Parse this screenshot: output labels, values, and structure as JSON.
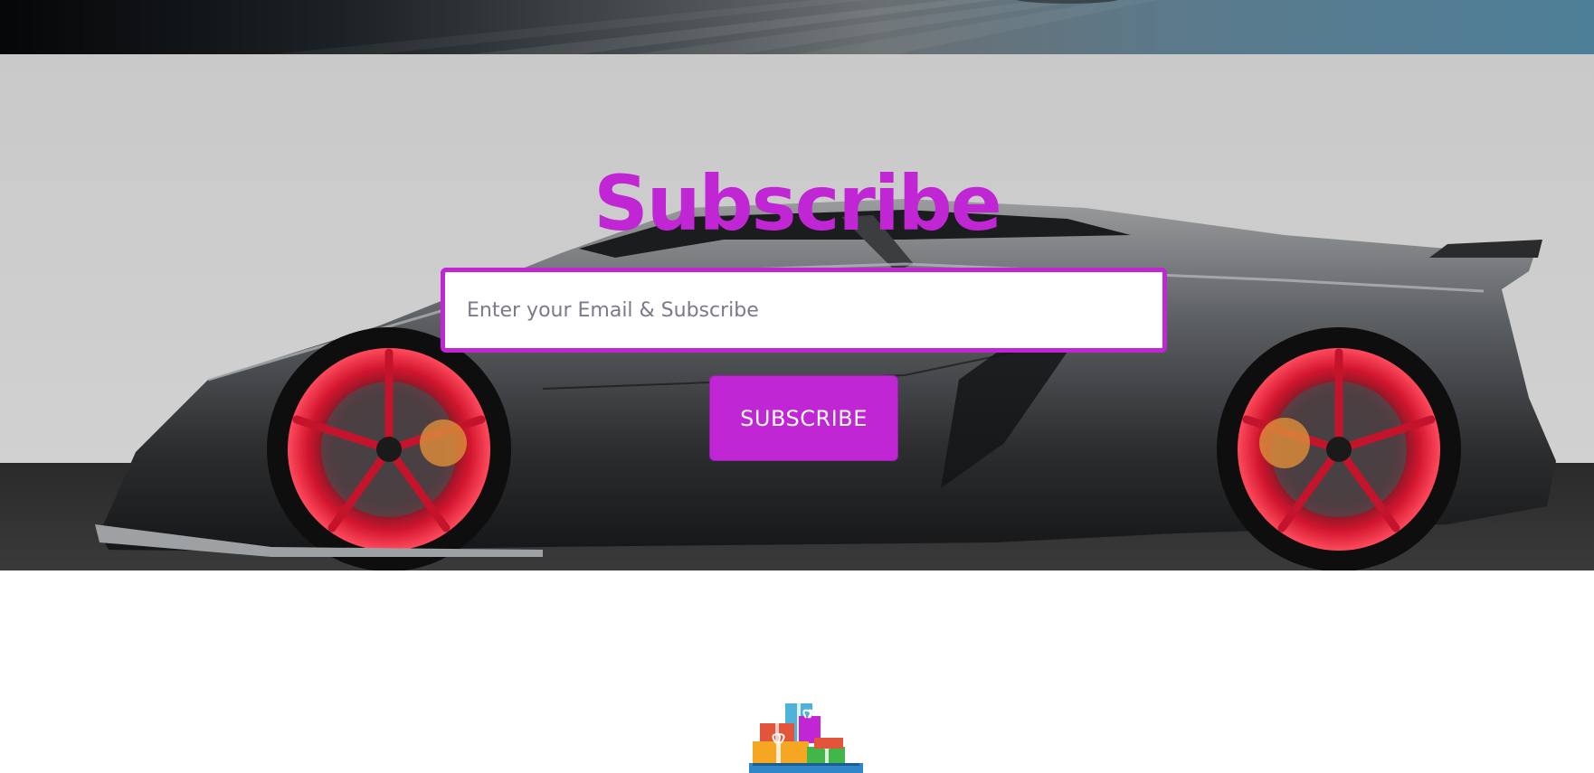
{
  "subscribe": {
    "title": "Subscribe",
    "email_placeholder": "Enter your Email & Subscribe",
    "email_value": "",
    "button_label": "SUBSCRIBE"
  },
  "colors": {
    "accent": "#c026d3",
    "hero_background": "#cbcbcb",
    "wheel_red": "#d1152e"
  },
  "icons": {
    "hero_image": "sports-car-image",
    "footer_icon": "gift-boxes-icon"
  }
}
